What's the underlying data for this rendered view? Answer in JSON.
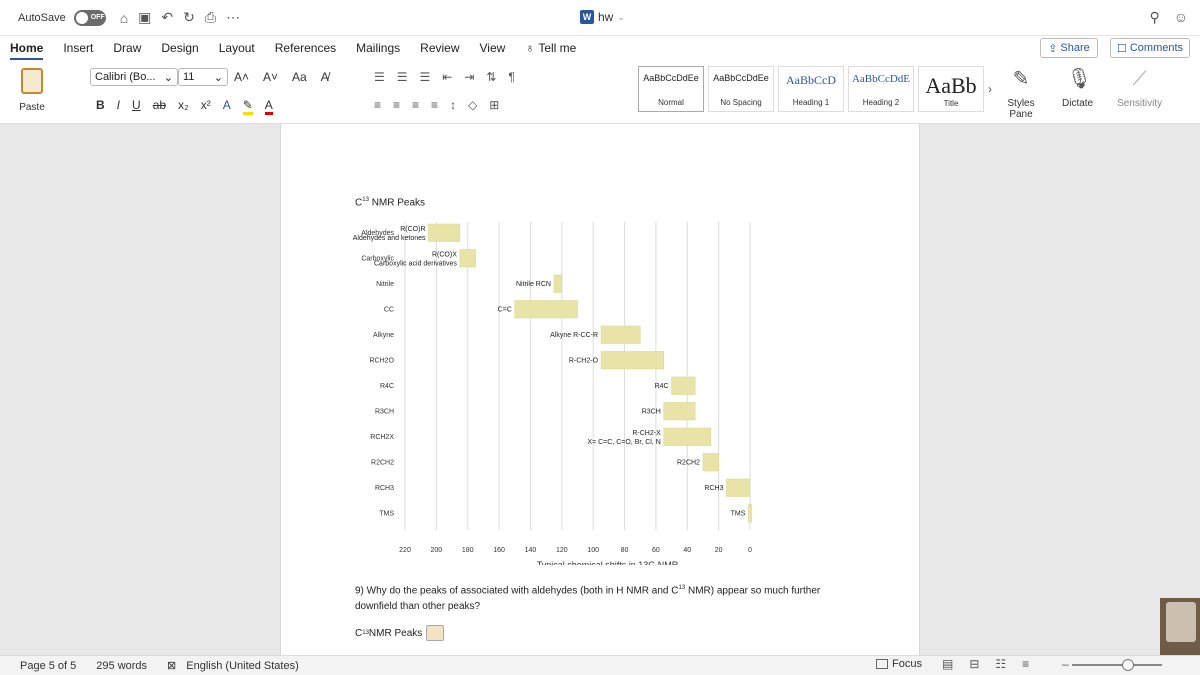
{
  "titlebar": {
    "autosave_label": "AutoSave",
    "autosave_state": "OFF",
    "doc_title": "hw",
    "word_icon": "W"
  },
  "tabs": {
    "items": [
      "Home",
      "Insert",
      "Draw",
      "Design",
      "Layout",
      "References",
      "Mailings",
      "Review",
      "View"
    ],
    "tell_me": "Tell me",
    "share": "Share",
    "comments": "Comments"
  },
  "ribbon": {
    "paste_label": "Paste",
    "font_name": "Calibri (Bo...",
    "font_size": "11",
    "case_label": "Aa",
    "styles": [
      {
        "preview": "AaBbCcDdEe",
        "name": "Normal",
        "kind": "normal"
      },
      {
        "preview": "AaBbCcDdEe",
        "name": "No Spacing",
        "kind": "normal"
      },
      {
        "preview": "AaBbCcD",
        "name": "Heading 1",
        "kind": "heading"
      },
      {
        "preview": "AaBbCcDdE",
        "name": "Heading 2",
        "kind": "heading"
      },
      {
        "preview": "AaBb",
        "name": "Title",
        "kind": "title"
      }
    ],
    "styles_pane": "Styles Pane",
    "dictate": "Dictate",
    "sensitivity": "Sensitivity"
  },
  "document": {
    "heading": "C",
    "heading_sup": "13",
    "heading_rest": " NMR Peaks",
    "question": "9) Why do the peaks of associated with aldehydes (both in H NMR and C",
    "question_sup": "13",
    "question_rest": " NMR) appear so much further downfield than other peaks?",
    "footer_label": "C",
    "footer_sup": "13",
    "footer_rest": " NMR Peaks"
  },
  "chart_data": {
    "type": "bar",
    "title": "",
    "xlabel": "Typical chemical shifts in 13C-NMR",
    "ylabel": "",
    "xlim": [
      220,
      0
    ],
    "x_ticks": [
      220,
      200,
      180,
      160,
      140,
      120,
      100,
      80,
      60,
      40,
      20,
      0
    ],
    "grid": true,
    "categories": [
      "Aldehydes",
      "Carboxylic",
      "Nitrile",
      "CC",
      "Alkyne",
      "RCH2O",
      "R4C",
      "R3CH",
      "RCH2X",
      "R2CH2",
      "RCH3",
      "TMS"
    ],
    "ranges": [
      {
        "category": "Aldehydes",
        "start": 205,
        "end": 185,
        "label": "R(CO)R",
        "label2": "Aldehydes and ketones"
      },
      {
        "category": "Carboxylic",
        "start": 185,
        "end": 175,
        "label": "R(CO)X",
        "label2": "Carboxylic acid derivatives"
      },
      {
        "category": "Nitrile",
        "start": 125,
        "end": 120,
        "label": "Nitrile RCN",
        "label2": ""
      },
      {
        "category": "CC",
        "start": 150,
        "end": 110,
        "label": "C=C",
        "label2": ""
      },
      {
        "category": "Alkyne",
        "start": 95,
        "end": 70,
        "label": "Alkyne R-CC-R",
        "label2": ""
      },
      {
        "category": "RCH2O",
        "start": 95,
        "end": 55,
        "label": "R-CH2-O",
        "label2": ""
      },
      {
        "category": "R4C",
        "start": 50,
        "end": 35,
        "label": "R4C",
        "label2": ""
      },
      {
        "category": "R3CH",
        "start": 55,
        "end": 35,
        "label": "R3CH",
        "label2": ""
      },
      {
        "category": "RCH2X",
        "start": 55,
        "end": 25,
        "label": "R-CH2-X",
        "label2": "X= C=C, C=O, Br, Cl, N"
      },
      {
        "category": "R2CH2",
        "start": 30,
        "end": 20,
        "label": "R2CH2",
        "label2": ""
      },
      {
        "category": "RCH3",
        "start": 15,
        "end": 0,
        "label": "RCH3",
        "label2": ""
      },
      {
        "category": "TMS",
        "start": 1,
        "end": -1,
        "label": "TMS",
        "label2": ""
      }
    ],
    "bar_color": "#e8e4a8"
  },
  "status": {
    "page": "Page 5 of 5",
    "words": "295 words",
    "language": "English (United States)",
    "focus": "Focus"
  }
}
